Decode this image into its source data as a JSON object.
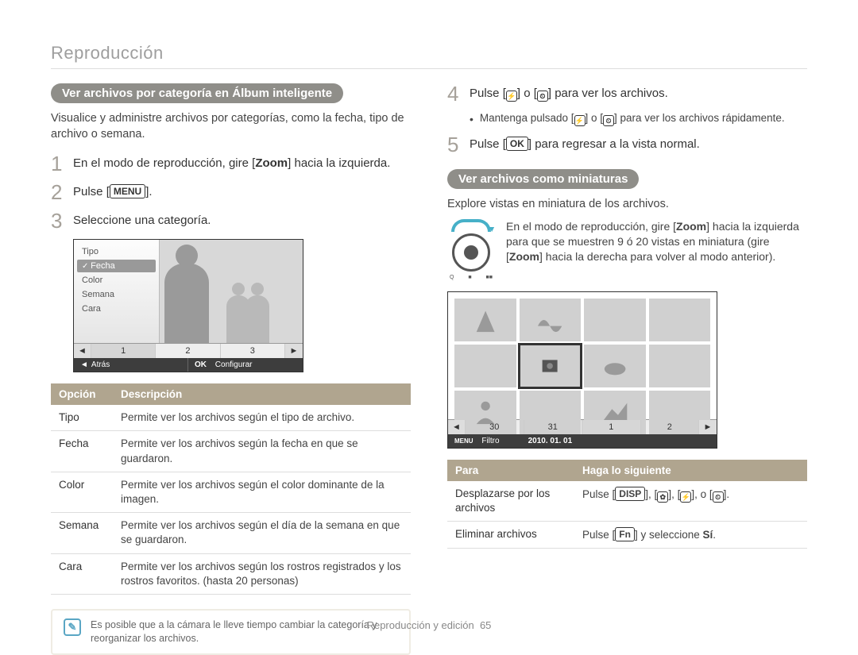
{
  "header": {
    "section": "Reproducción"
  },
  "left": {
    "pill": "Ver archivos por categoría en Álbum inteligente",
    "intro": "Visualice y administre archivos por categorías, como la fecha, tipo de archivo o semana.",
    "steps": {
      "s1": {
        "n": "1",
        "pre": "En el modo de reproducción, gire [",
        "bold": "Zoom",
        "post": "] hacia la izquierda."
      },
      "s2": {
        "n": "2",
        "pre": "Pulse [",
        "btn": "MENU",
        "post": "]."
      },
      "s3": {
        "n": "3",
        "text": "Seleccione una categoría."
      }
    },
    "cam_menu": [
      "Tipo",
      "Fecha",
      "Color",
      "Semana",
      "Cara"
    ],
    "cam_strip": {
      "arrow_l": "◄",
      "c1": "1",
      "c2": "2",
      "c3": "3",
      "arrow_r": "►"
    },
    "cam_foot": {
      "back_icon": "◄",
      "back": "Atrás",
      "ok": "OK",
      "config": "Configurar"
    },
    "table": {
      "h1": "Opción",
      "h2": "Descripción",
      "rows": [
        {
          "k": "Tipo",
          "v": "Permite ver los archivos según el tipo de archivo."
        },
        {
          "k": "Fecha",
          "v": "Permite ver los archivos según la fecha en que se guardaron."
        },
        {
          "k": "Color",
          "v": "Permite ver los archivos según el color dominante de la imagen."
        },
        {
          "k": "Semana",
          "v": "Permite ver los archivos según el día de la semana en que se guardaron."
        },
        {
          "k": "Cara",
          "v": "Permite ver los archivos según los rostros registrados y los rostros favoritos. (hasta 20 personas)"
        }
      ]
    },
    "note": "Es posible que a la cámara le lleve tiempo cambiar la categoría y reorganizar los archivos."
  },
  "right": {
    "step4": {
      "n": "4",
      "pre": "Pulse [",
      "mid": "] o [",
      "post": "] para ver los archivos."
    },
    "step4_sub": {
      "pre": "Mantenga pulsado [",
      "mid": "] o [",
      "post": "] para ver los archivos rápidamente."
    },
    "step5": {
      "n": "5",
      "pre": "Pulse [",
      "btn": "OK",
      "post": "] para regresar a la vista normal."
    },
    "pill": "Ver archivos como miniaturas",
    "intro": "Explore vistas en miniatura de los archivos.",
    "zoom_text": {
      "p1": "En el modo de reproducción, gire [",
      "z1": "Zoom",
      "p2": "] hacia la izquierda para que se muestren 9 ó 20 vistas en miniatura (gire [",
      "z2": "Zoom",
      "p3": "] hacia la derecha para volver al modo anterior)."
    },
    "dial_labels": {
      "l": "Q",
      "m": "■",
      "r": "■■"
    },
    "thumb_strip": {
      "arrow_l": "◄",
      "c1": "30",
      "c2": "31",
      "c3": "1",
      "c4": "2",
      "arrow_r": "►"
    },
    "thumb_foot": {
      "menu": "MENU",
      "filter": "Filtro",
      "date": "2010. 01. 01"
    },
    "table": {
      "h1": "Para",
      "h2": "Haga lo siguiente",
      "rows": [
        {
          "k": "Desplazarse por los archivos",
          "pre": "Pulse [",
          "b1": "DISP",
          "mid1": "], [",
          "i1": "✿",
          "mid2": "], [",
          "i2": "⚡",
          "mid3": "], o [",
          "i3": "⏲",
          "post": "]."
        },
        {
          "k": "Eliminar archivos",
          "pre": "Pulse [",
          "b1": "Fn",
          "mid": "] y seleccione ",
          "bold": "Sí",
          "post": "."
        }
      ]
    }
  },
  "footer": {
    "text": "Reproducción y edición",
    "page": "65"
  },
  "icons": {
    "flash": "⚡",
    "timer": "⏲",
    "flower": "✿"
  }
}
